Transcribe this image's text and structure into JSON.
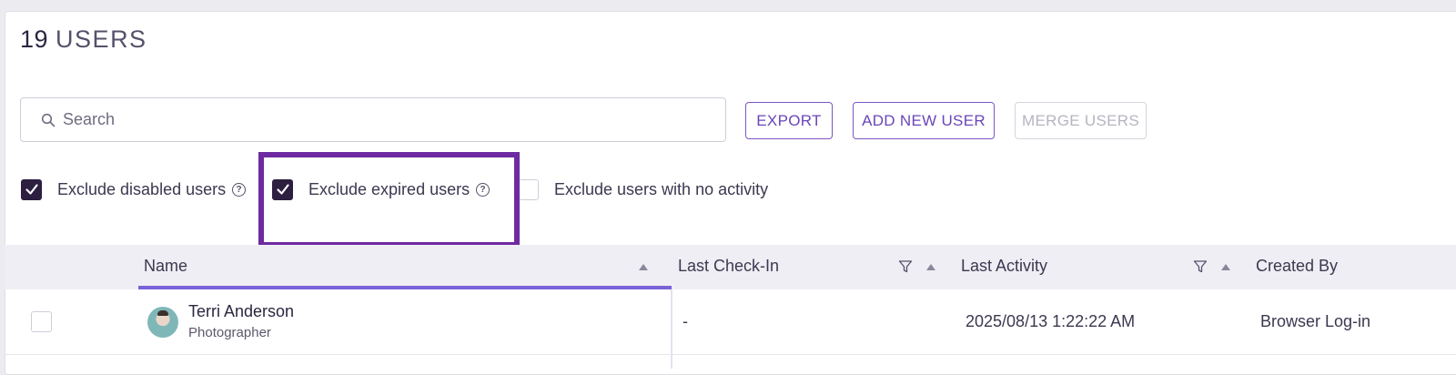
{
  "header": {
    "count": "19",
    "label": "USERS"
  },
  "search": {
    "placeholder": "Search"
  },
  "toolbar": {
    "export_label": "EXPORT",
    "add_label": "ADD NEW USER",
    "merge_label": "MERGE USERS"
  },
  "filters": [
    {
      "label": "Exclude disabled users",
      "checked": true,
      "help": "?"
    },
    {
      "label": "Exclude expired users",
      "checked": true,
      "help": "?"
    },
    {
      "label": "Exclude users with no activity",
      "checked": false
    }
  ],
  "table": {
    "columns": [
      "Name",
      "Last Check-In",
      "Last Activity",
      "Created By"
    ],
    "rows": [
      {
        "name": "Terri Anderson",
        "role": "Photographer",
        "last_checkin": "-",
        "last_activity": "2025/08/13 1:22:22 AM",
        "created_by": "Browser Log-in"
      }
    ]
  },
  "colors": {
    "accent": "#6a46b8",
    "highlight": "#6e2aa0",
    "checkbox_checked": "#2c1f3f"
  }
}
